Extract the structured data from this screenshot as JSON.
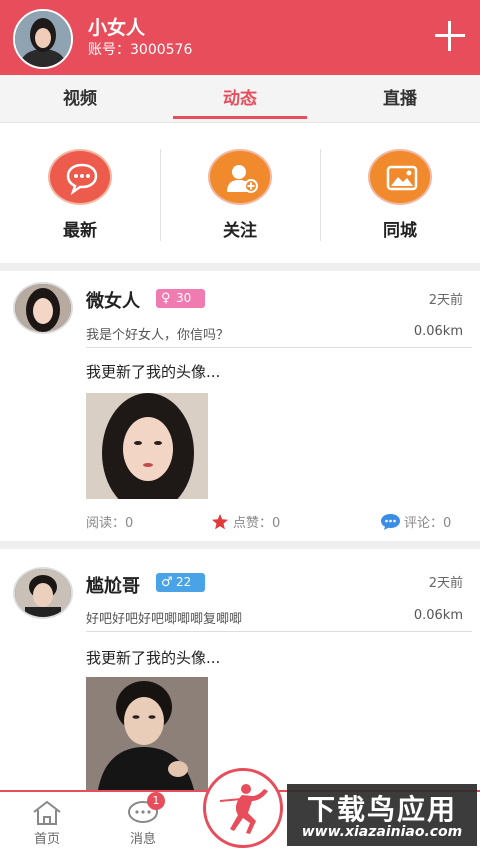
{
  "header": {
    "username": "小女人",
    "account": "账号：3000576",
    "add_icon": "plus-icon"
  },
  "tabs": [
    {
      "label": "视频",
      "active": false
    },
    {
      "label": "动态",
      "active": true
    },
    {
      "label": "直播",
      "active": false
    }
  ],
  "categories": [
    {
      "label": "最新",
      "icon": "chat-bubble-icon",
      "color": "#ec5b4b"
    },
    {
      "label": "关注",
      "icon": "add-user-icon",
      "color": "#f08a2c"
    },
    {
      "label": "同城",
      "icon": "image-landscape-icon",
      "color": "#f08a2c"
    }
  ],
  "posts": [
    {
      "name": "微女人",
      "gender_symbol": "♀",
      "age": "30",
      "badge_color": "#f07bb0",
      "time": "2天前",
      "signature": "我是个好女人，你信吗？",
      "distance": "0.06km",
      "text": "我更新了我的头像...",
      "reads": "阅读：0",
      "likes": "点赞：0",
      "comments": "评论：0"
    },
    {
      "name": "尴尬哥",
      "gender_symbol": "♂",
      "age": "22",
      "badge_color": "#4aa3e6",
      "time": "2天前",
      "signature": "好吧好吧好吧唧唧唧复唧唧",
      "distance": "0.06km",
      "text": "我更新了我的头像..."
    }
  ],
  "bottom_nav": [
    {
      "label": "首页",
      "icon": "home-icon"
    },
    {
      "label": "消息",
      "icon": "message-icon",
      "badge": "1"
    }
  ],
  "center_button_icon": "dancer-icon",
  "watermark": {
    "title": "下载鸟应用",
    "url": "www.xiazainiao.com"
  }
}
